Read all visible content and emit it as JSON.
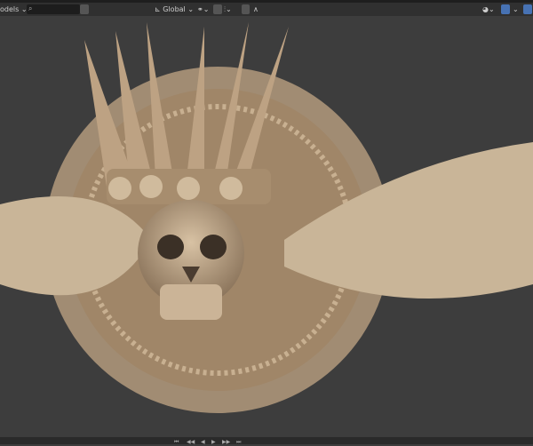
{
  "header": {
    "collection_label": "odels",
    "search_placeholder": "",
    "orientation": "Global"
  },
  "bottom": {
    "playback": [
      "⏮",
      "◀◀",
      "◀",
      "▶",
      "▶▶",
      "⏭"
    ]
  },
  "colors": {
    "bg": "#3d3d3d",
    "model": "#c2a88a",
    "accent": "#4772b3"
  }
}
